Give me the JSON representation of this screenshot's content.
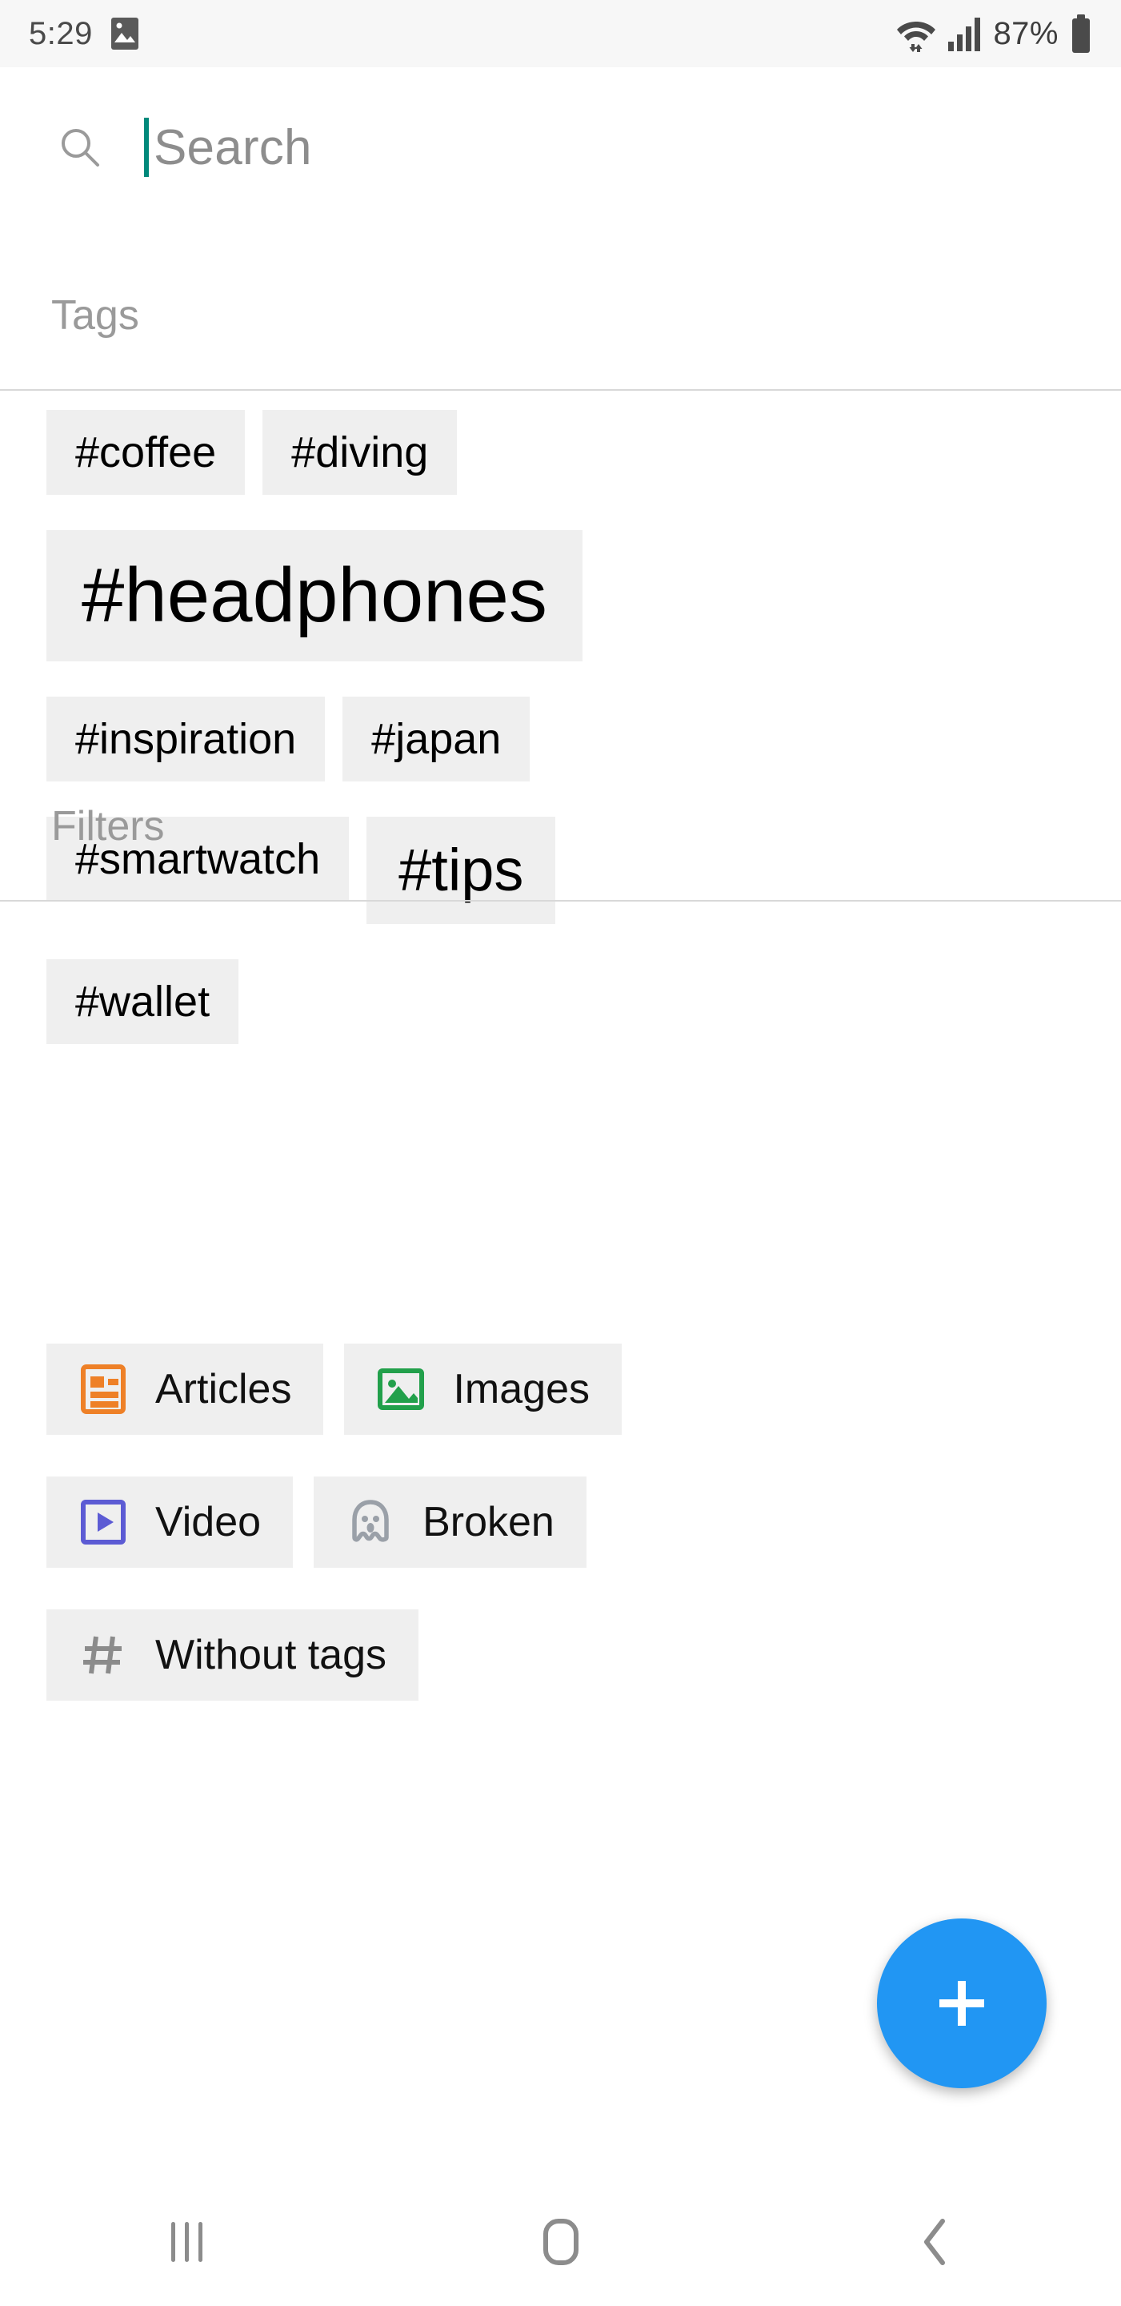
{
  "status_bar": {
    "time": "5:29",
    "battery_percent": "87%",
    "icons": [
      "image-icon",
      "wifi-icon",
      "signal-icon",
      "battery-icon"
    ]
  },
  "search": {
    "placeholder": "Search",
    "value": "",
    "icon": "search-icon",
    "caret_color": "#00897b"
  },
  "sections": {
    "tags_title": "Tags",
    "filters_title": "Filters"
  },
  "tags": [
    {
      "label": "#coffee",
      "size": 1
    },
    {
      "label": "#diving",
      "size": 1
    },
    {
      "label": "#headphones",
      "size": 3
    },
    {
      "label": "#inspiration",
      "size": 1
    },
    {
      "label": "#japan",
      "size": 1
    },
    {
      "label": "#smartwatch",
      "size": 1
    },
    {
      "label": "#tips",
      "size": 2
    },
    {
      "label": "#wallet",
      "size": 1
    }
  ],
  "filters": [
    {
      "label": "Articles",
      "icon": "article-icon",
      "color": "#ee8027"
    },
    {
      "label": "Images",
      "icon": "image-icon",
      "color": "#22a04b"
    },
    {
      "label": "Video",
      "icon": "video-icon",
      "color": "#5c5bd4"
    },
    {
      "label": "Broken",
      "icon": "ghost-icon",
      "color": "#9aa0a8"
    },
    {
      "label": "Without tags",
      "icon": "hash-icon",
      "color": "#8b8b8b"
    }
  ],
  "fab": {
    "icon": "plus-icon",
    "color": "#2196f3",
    "label": "Add"
  },
  "navigation_bar": {
    "recents": "recents-icon",
    "home": "home-icon",
    "back": "back-icon"
  }
}
